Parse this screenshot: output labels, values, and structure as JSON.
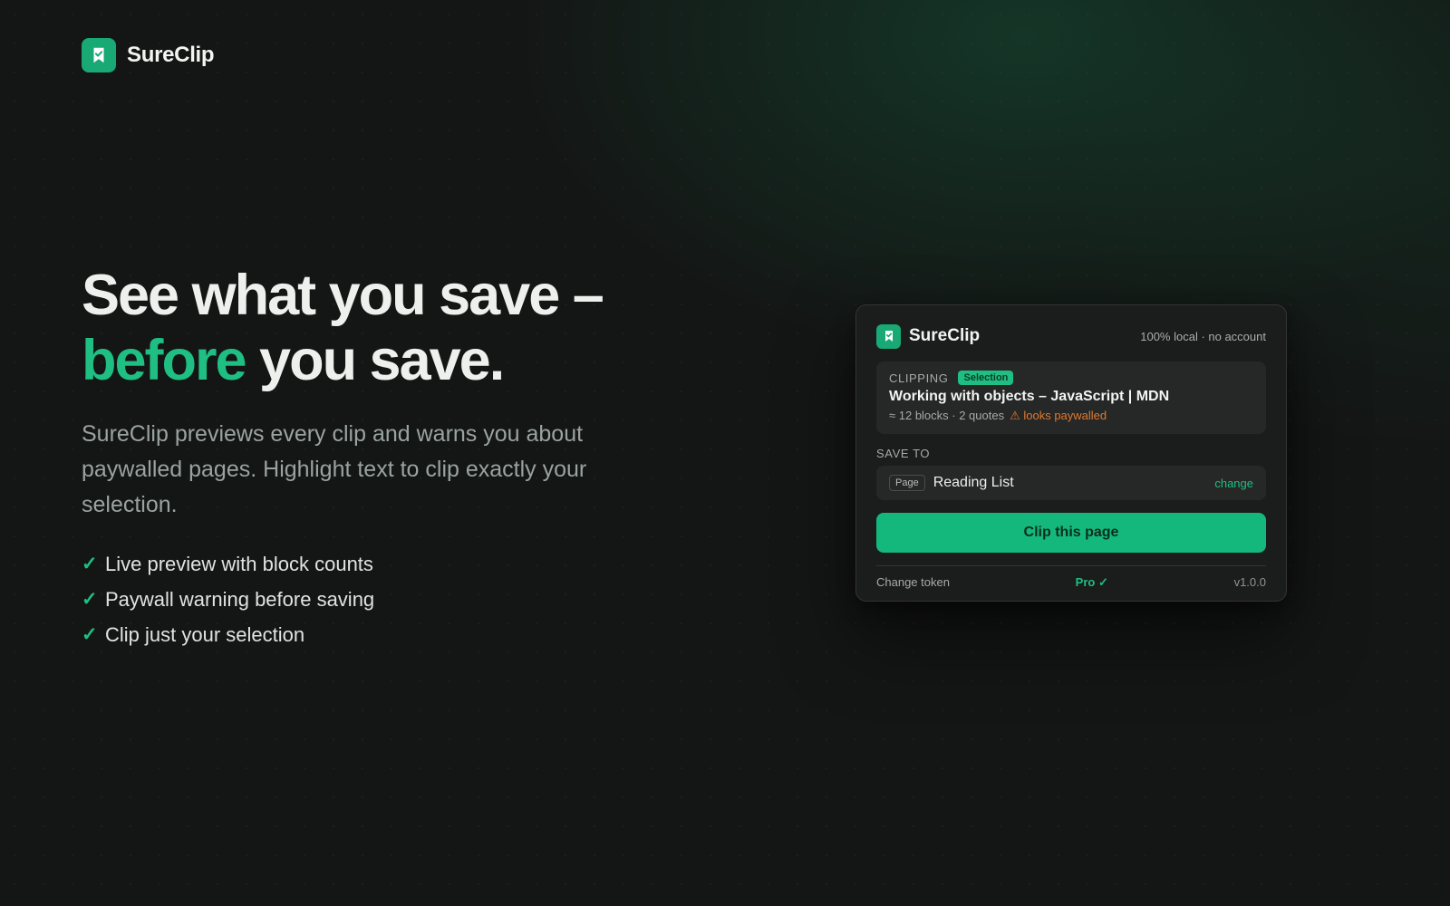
{
  "brand": {
    "name": "SureClip",
    "icon": "bookmark-check-icon",
    "color": "#18a974"
  },
  "hero": {
    "title_line1": "See what you save –",
    "title_accent": "before",
    "title_line2_rest": " you save.",
    "subtitle": "SureClip previews every clip and warns you about paywalled pages. Highlight text to clip exactly your selection.",
    "features": [
      "Live preview with block counts",
      "Paywall warning before saving",
      "Clip just your selection"
    ],
    "check_glyph": "✓"
  },
  "popup": {
    "app_name": "SureClip",
    "meta": "100% local · no account",
    "clipping": {
      "label": "CLIPPING",
      "badge": "Selection",
      "title": "Working with objects – JavaScript | MDN",
      "stats": "≈ 12 blocks · 2 quotes",
      "warning": "⚠ looks paywalled"
    },
    "save_to": {
      "label": "SAVE TO",
      "chip": "Page",
      "destination": "Reading List",
      "change_label": "change"
    },
    "primary_button": "Clip this page",
    "footer": {
      "token_label": "Change token",
      "plan": "Pro ✓",
      "version": "v1.0.0"
    }
  },
  "colors": {
    "accent": "#1fbf83",
    "warning": "#e07a2e",
    "background": "#141615",
    "card": "#1b1c1c"
  }
}
